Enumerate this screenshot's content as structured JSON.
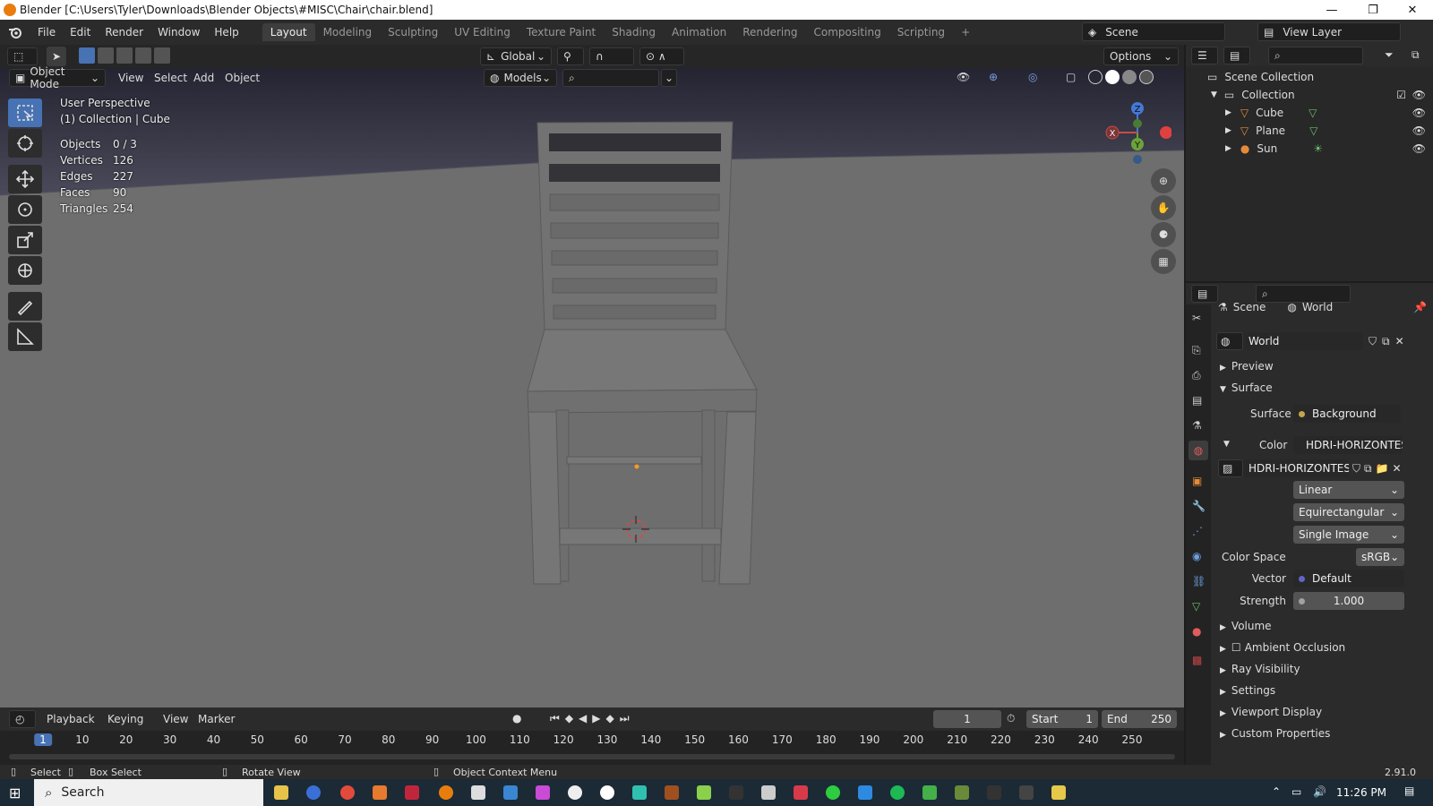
{
  "titlebar": {
    "title": "Blender [C:\\Users\\Tyler\\Downloads\\Blender Objects\\#MISC\\Chair\\chair.blend]",
    "minimize": "—",
    "maximize": "❐",
    "close": "✕"
  },
  "menus": [
    "File",
    "Edit",
    "Render",
    "Window",
    "Help"
  ],
  "workspaces": [
    "Layout",
    "Modeling",
    "Sculpting",
    "UV Editing",
    "Texture Paint",
    "Shading",
    "Animation",
    "Rendering",
    "Compositing",
    "Scripting"
  ],
  "active_workspace": "Layout",
  "add_workspace": "+",
  "scene": {
    "name": "Scene",
    "view_layer": "View Layer"
  },
  "viewport_header": {
    "transform_orientation": "Global",
    "options": "Options",
    "mode": "Object Mode",
    "menus": [
      "View",
      "Select",
      "Add",
      "Object"
    ],
    "collection_filter": "Models"
  },
  "viewport": {
    "perspective": "User Perspective",
    "collection": "(1) Collection | Cube",
    "stats": [
      {
        "label": "Objects",
        "value": "0 / 3"
      },
      {
        "label": "Vertices",
        "value": "126"
      },
      {
        "label": "Edges",
        "value": "227"
      },
      {
        "label": "Faces",
        "value": "90"
      },
      {
        "label": "Triangles",
        "value": "254"
      }
    ],
    "gizmo": {
      "x": "X",
      "y": "Y",
      "z": "Z"
    }
  },
  "outliner": {
    "root": "Scene Collection",
    "collection": "Collection",
    "items": [
      {
        "name": "Cube",
        "icon": "mesh-icon"
      },
      {
        "name": "Plane",
        "icon": "mesh-icon"
      },
      {
        "name": "Sun",
        "icon": "light-icon"
      }
    ]
  },
  "properties": {
    "breadcrumb_scene": "Scene",
    "breadcrumb_world": "World",
    "world_name": "World",
    "panels": {
      "preview": "Preview",
      "surface": "Surface",
      "volume": "Volume",
      "ambient_occlusion": "Ambient Occlusion",
      "ray_visibility": "Ray Visibility",
      "settings": "Settings",
      "viewport_display": "Viewport Display",
      "custom_properties": "Custom Properties"
    },
    "surface_label": "Surface",
    "surface_value": "Background",
    "color_label": "Color",
    "color_value": "HDRI-HORIZONTES-...",
    "image_name": "HDRI-HORIZONTES-...",
    "interpolation": "Linear",
    "projection": "Equirectangular",
    "source": "Single Image",
    "color_space_label": "Color Space",
    "color_space": "sRGB",
    "vector_label": "Vector",
    "vector_value": "Default",
    "strength_label": "Strength",
    "strength_value": "1.000"
  },
  "timeline": {
    "menus": [
      "Playback",
      "Keying",
      "View",
      "Marker"
    ],
    "current_frame": "1",
    "start_label": "Start",
    "start": "1",
    "end_label": "End",
    "end": "250",
    "ticks": [
      "1",
      "10",
      "20",
      "30",
      "40",
      "50",
      "60",
      "70",
      "80",
      "90",
      "100",
      "110",
      "120",
      "130",
      "140",
      "150",
      "160",
      "170",
      "180",
      "190",
      "200",
      "210",
      "220",
      "230",
      "240",
      "250"
    ]
  },
  "statusbar": {
    "select": "Select",
    "box_select": "Box Select",
    "rotate_view": "Rotate View",
    "context_menu": "Object Context Menu",
    "version": "2.91.0"
  },
  "taskbar": {
    "search": "Search",
    "time": "11:26 PM"
  }
}
